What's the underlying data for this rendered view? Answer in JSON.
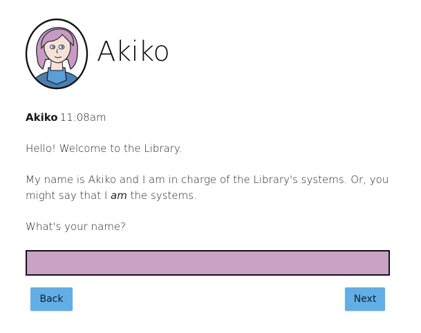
{
  "character": {
    "name": "Akiko",
    "avatar_icon": "akiko-portrait"
  },
  "message": {
    "sender": "Akiko",
    "time": "11:08am",
    "line1": "Hello! Welcome to the Library.",
    "line2_part1": "My name is Akiko and I am in charge of the Library's systems. Or, you might say that I ",
    "line2_emphasis": "am",
    "line2_part2": " the systems.",
    "line3": "What's your name?"
  },
  "form": {
    "name_value": "",
    "name_placeholder": ""
  },
  "buttons": {
    "back_label": "Back",
    "next_label": "Next"
  },
  "colors": {
    "input_fill": "#c9a2c5",
    "button_fill": "#62aee6",
    "hair": "#c79bc4",
    "shirt": "#5a9fd8"
  }
}
